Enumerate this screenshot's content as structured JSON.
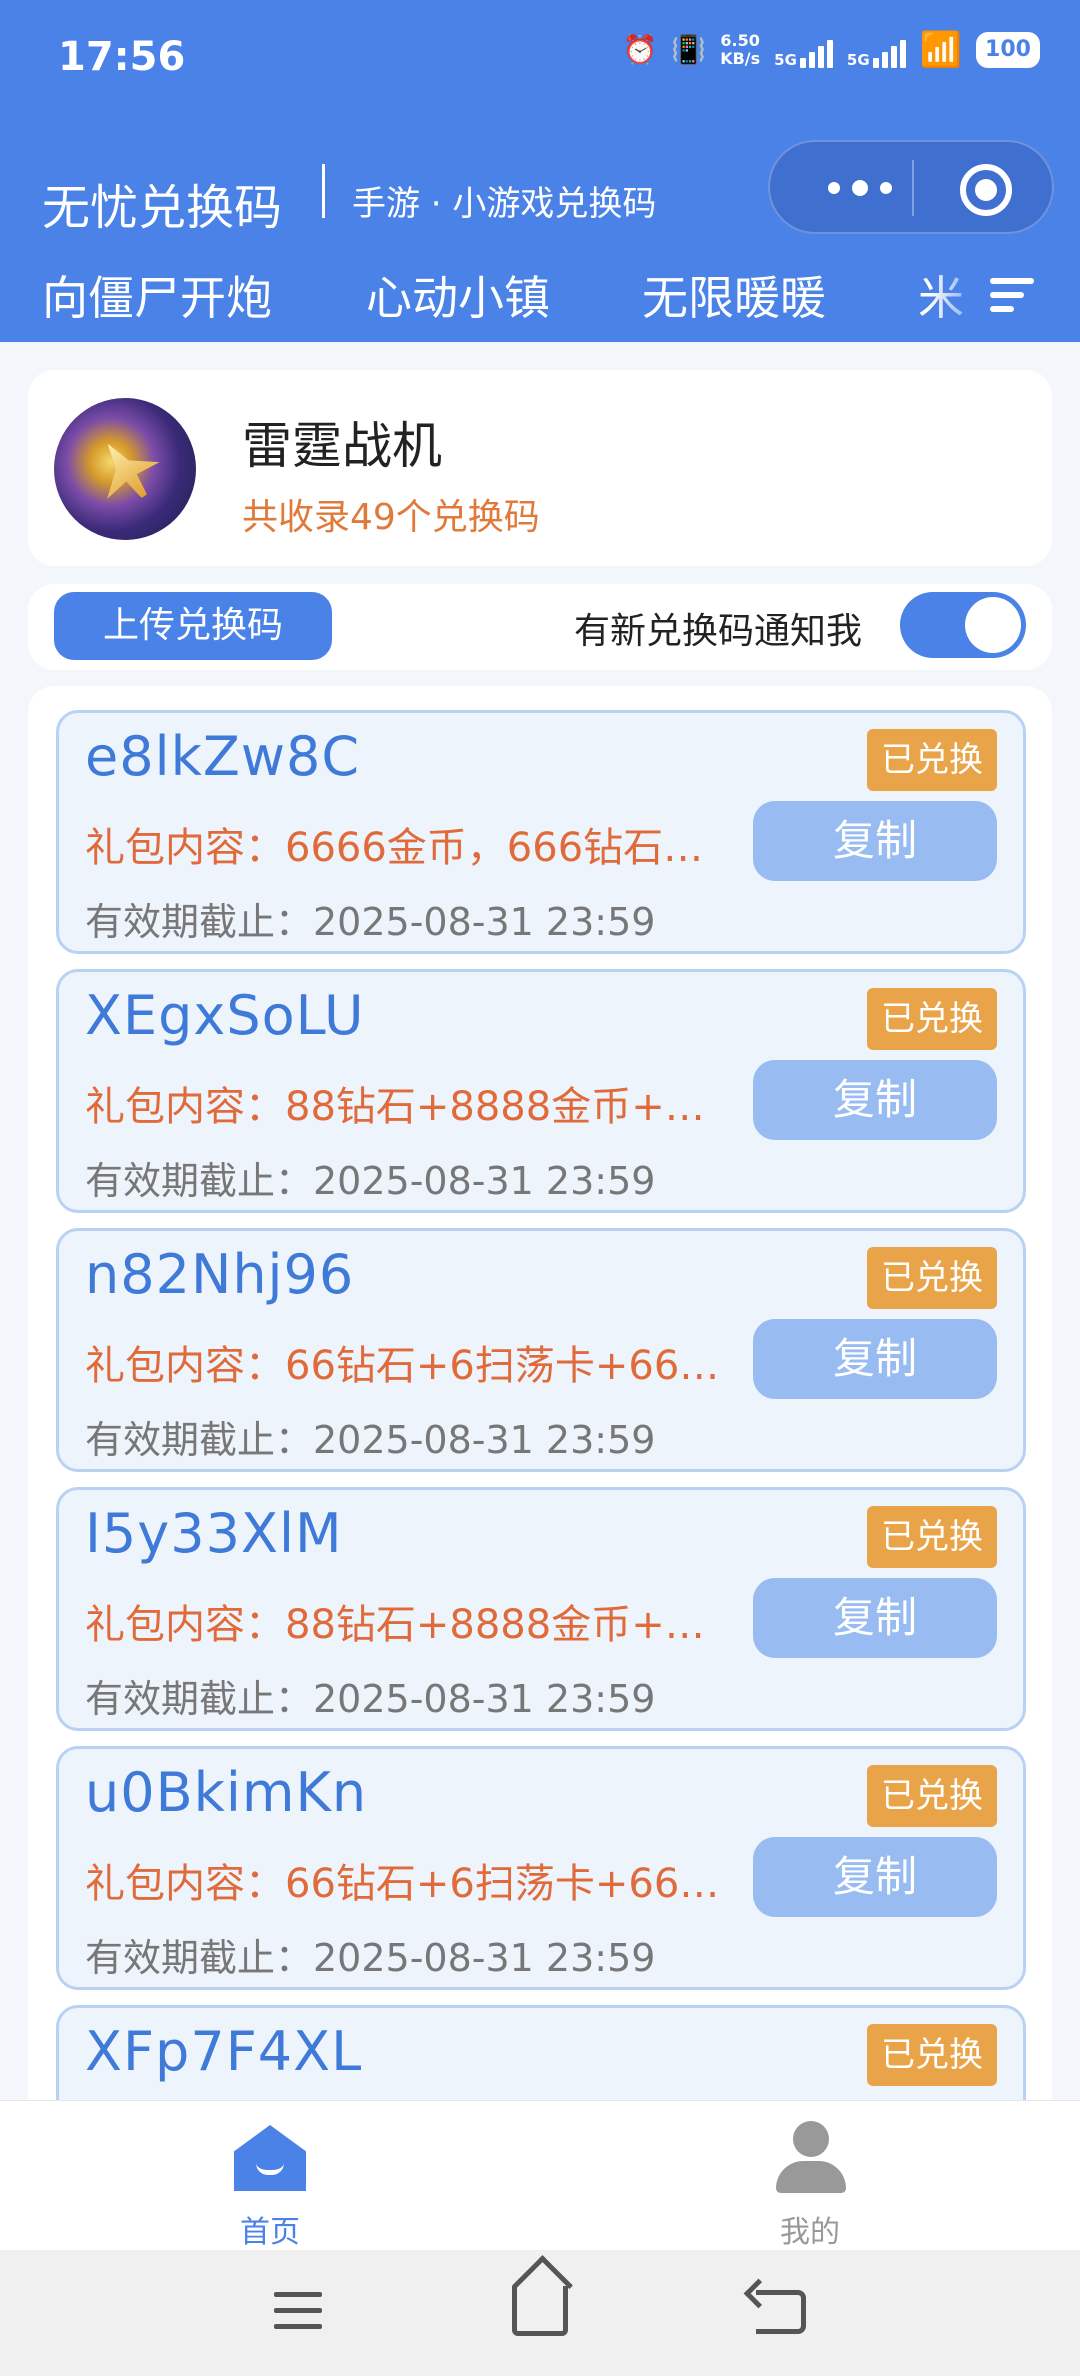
{
  "status_bar": {
    "time": "17:56",
    "net_speed_value": "6.50",
    "net_speed_unit": "KB/s",
    "sim1": "5G",
    "sim2": "5G",
    "battery": "100"
  },
  "header": {
    "app_title": "无忧兑换码",
    "subtitle": "手游 · 小游戏兑换码",
    "tabs": [
      "向僵尸开炮",
      "心动小镇",
      "无限暖暖",
      "米"
    ]
  },
  "game": {
    "name": "雷霆战机",
    "count_text": "共收录49个兑换码"
  },
  "actions": {
    "upload_label": "上传兑换码",
    "notify_label": "有新兑换码通知我",
    "notify_on": true
  },
  "codes": [
    {
      "code": "e8lkZw8C",
      "status": "已兑换",
      "content": "礼包内容：6666金币，666钻石…",
      "copy": "复制",
      "expiry": "有效期截止：2025-08-31 23:59"
    },
    {
      "code": "XEgxSoLU",
      "status": "已兑换",
      "content": "礼包内容：88钻石+8888金币+8…",
      "copy": "复制",
      "expiry": "有效期截止：2025-08-31 23:59"
    },
    {
      "code": "n82Nhj96",
      "status": "已兑换",
      "content": "礼包内容：66钻石+6扫荡卡+66…",
      "copy": "复制",
      "expiry": "有效期截止：2025-08-31 23:59"
    },
    {
      "code": "I5y33XlM",
      "status": "已兑换",
      "content": "礼包内容：88钻石+8888金币+8…",
      "copy": "复制",
      "expiry": "有效期截止：2025-08-31 23:59"
    },
    {
      "code": "u0BkimKn",
      "status": "已兑换",
      "content": "礼包内容：66钻石+6扫荡卡+66…",
      "copy": "复制",
      "expiry": "有效期截止：2025-08-31 23:59"
    },
    {
      "code": "XFp7F4XL",
      "status": "已兑换",
      "content": "",
      "copy": "",
      "expiry": ""
    }
  ],
  "tabbar": {
    "home_label": "首页",
    "mine_label": "我的",
    "active_color": "#4a82e8",
    "inactive_color": "#999999"
  },
  "colors": {
    "primary": "#4a82e8",
    "badge": "#e9a44a",
    "content_text": "#e06a3a"
  }
}
